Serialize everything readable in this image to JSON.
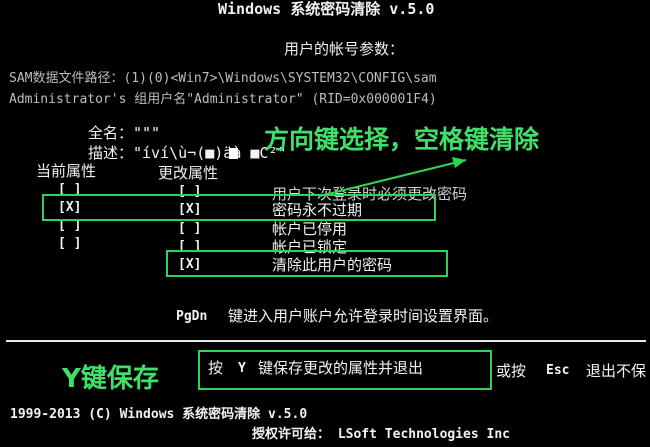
{
  "header": {
    "title": "Windows 系统密码清除 v.5.0",
    "account_params": "用户的帐号参数："
  },
  "info": {
    "sam_path": "SAM数据文件路径：(1)(0)<Win7>\\Windows\\SYSTEM32\\CONFIG\\sam",
    "admin_line": "Administrator's 组用户名\"Administrator\" (RID=0x000001F4)"
  },
  "fields": {
    "fullname": "全名：\"\"\"",
    "description": "描述：\"íví\\ù¬(■)äà ■C²\""
  },
  "columns": {
    "current": "当前属性",
    "changed": "更改属性"
  },
  "attributes": [
    {
      "current": "[ ]",
      "changed": "[ ]",
      "label": "用户下次登录时必须更改密码"
    },
    {
      "current": "[X]",
      "changed": "[X]",
      "label": "密码永不过期"
    },
    {
      "current": "[ ]",
      "changed": "[ ]",
      "label": "帐户已停用"
    },
    {
      "current": "[ ]",
      "changed": "[ ]",
      "label": "帐户已锁定"
    },
    {
      "current": "",
      "changed": "[X]",
      "label": "清除此用户的密码"
    }
  ],
  "hints": {
    "pgdn_key": "PgDn",
    "pgdn_text": "键进入用户账户允许登录时间设置界面。",
    "save_press": "按",
    "save_key": "Y",
    "save_text": "键保存更改的属性并退出",
    "or_text": "或按",
    "esc_key": "Esc",
    "esc_text": "退出不保"
  },
  "annotations": {
    "arrow_hint": "方向键选择，空格键清除",
    "save_hint": "Y键保存",
    "color": "#3ee06a"
  },
  "footer": {
    "copyright": "1999-2013 (C) Windows 系统密码清除 v.5.0",
    "license": "授权许可给： LSoft Technologies Inc"
  }
}
